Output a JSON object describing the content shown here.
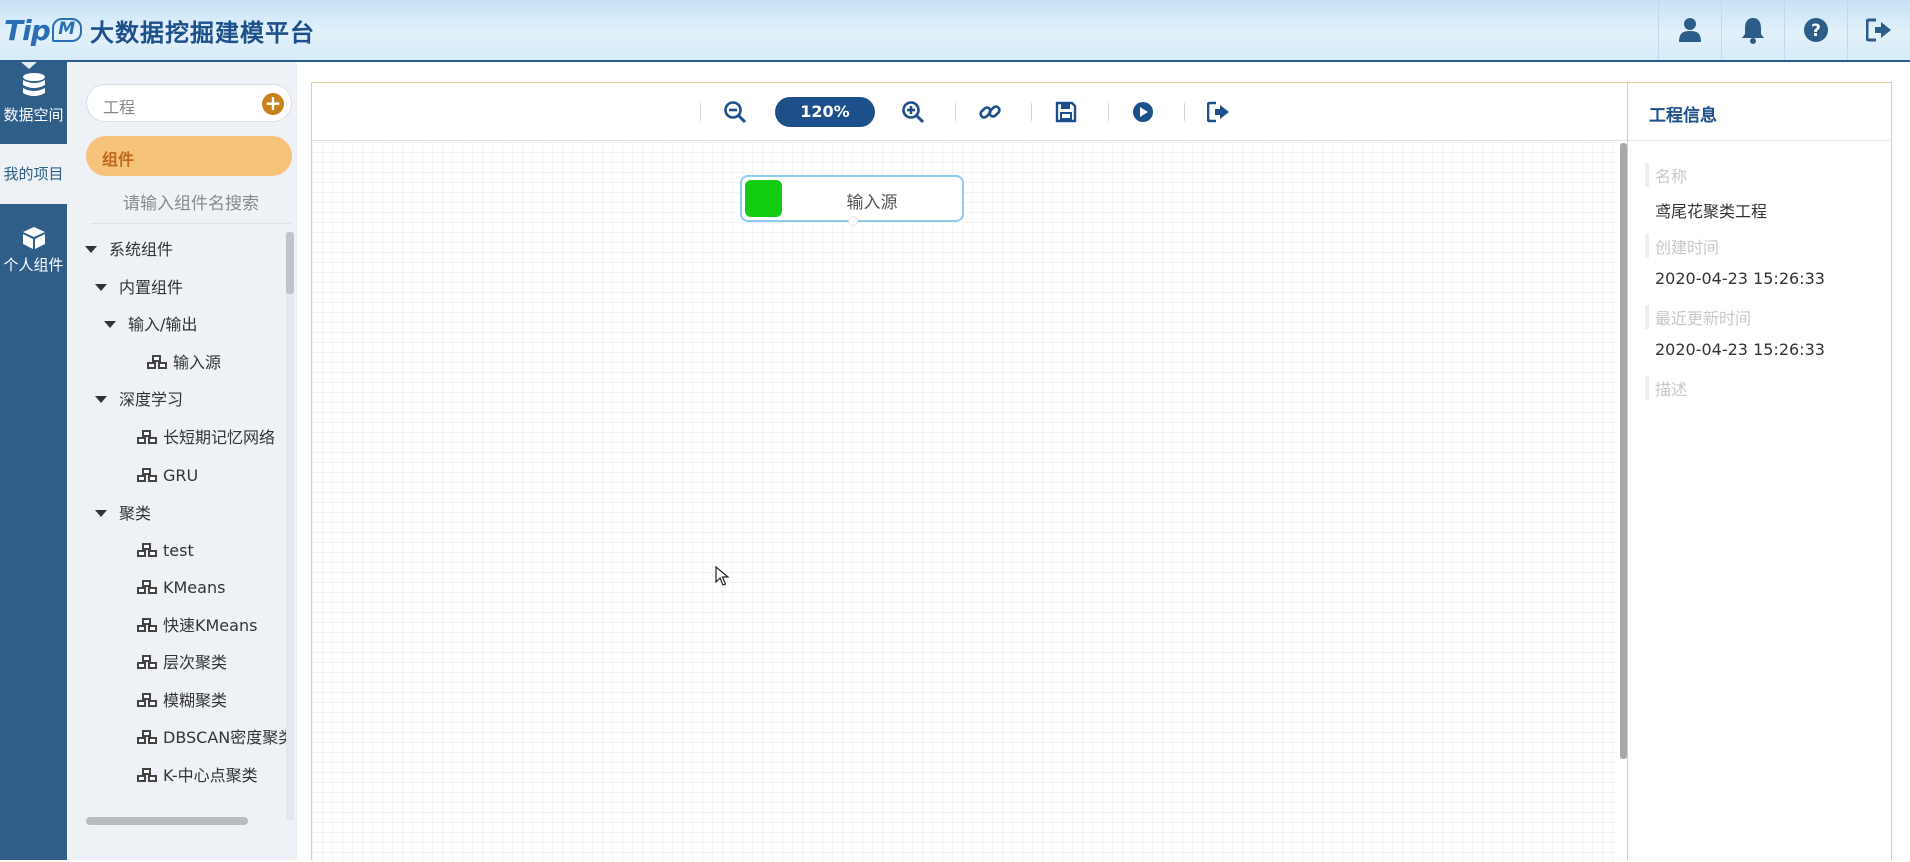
{
  "header": {
    "logo_text": "Tip",
    "logo_badge": "M",
    "title": "大数据挖掘建模平台",
    "icons": [
      "user-icon",
      "bell-icon",
      "help-icon",
      "logout-icon"
    ]
  },
  "rail": {
    "items": [
      {
        "label": "数据空间",
        "icon": "database-icon"
      },
      {
        "label": "我的项目",
        "icon": "none"
      },
      {
        "label": "个人组件",
        "icon": "cube-icon"
      }
    ]
  },
  "panel": {
    "project_label": "工程",
    "components_tab": "组件",
    "search_placeholder": "请输入组件名搜索",
    "tree": [
      {
        "label": "系统组件",
        "type": "folder",
        "level": 0
      },
      {
        "label": "内置组件",
        "type": "folder",
        "level": 1
      },
      {
        "label": "输入/输出",
        "type": "folder",
        "level": 2
      },
      {
        "label": "输入源",
        "type": "component",
        "level": 3
      },
      {
        "label": "深度学习",
        "type": "folder",
        "level": 1
      },
      {
        "label": "长短期记忆网络",
        "type": "component",
        "level": 2
      },
      {
        "label": "GRU",
        "type": "component",
        "level": 2
      },
      {
        "label": "聚类",
        "type": "folder",
        "level": 1
      },
      {
        "label": "test",
        "type": "component",
        "level": 2
      },
      {
        "label": "KMeans",
        "type": "component",
        "level": 2
      },
      {
        "label": "快速KMeans",
        "type": "component",
        "level": 2
      },
      {
        "label": "层次聚类",
        "type": "component",
        "level": 2
      },
      {
        "label": "模糊聚类",
        "type": "component",
        "level": 2
      },
      {
        "label": "DBSCAN密度聚类",
        "type": "component",
        "level": 2
      },
      {
        "label": "K-中心点聚类",
        "type": "component",
        "level": 2
      }
    ]
  },
  "toolbar": {
    "zoom": "120%",
    "buttons": [
      "zoom-out-icon",
      "zoom-in-icon",
      "link-icon",
      "save-icon",
      "run-icon",
      "export-icon"
    ]
  },
  "canvas": {
    "node": {
      "label": "输入源",
      "color": "#12cc12"
    }
  },
  "info": {
    "title": "工程信息",
    "name_label": "名称",
    "name_value": "鸢尾花聚类工程",
    "created_label": "创建时间",
    "created_value": "2020-04-23 15:26:33",
    "updated_label": "最近更新时间",
    "updated_value": "2020-04-23 15:26:33",
    "desc_label": "描述"
  },
  "colors": {
    "brand": "#1d4f8a",
    "rail": "#2f5e88",
    "accent": "#f6c37b",
    "node_green": "#12cc12"
  }
}
